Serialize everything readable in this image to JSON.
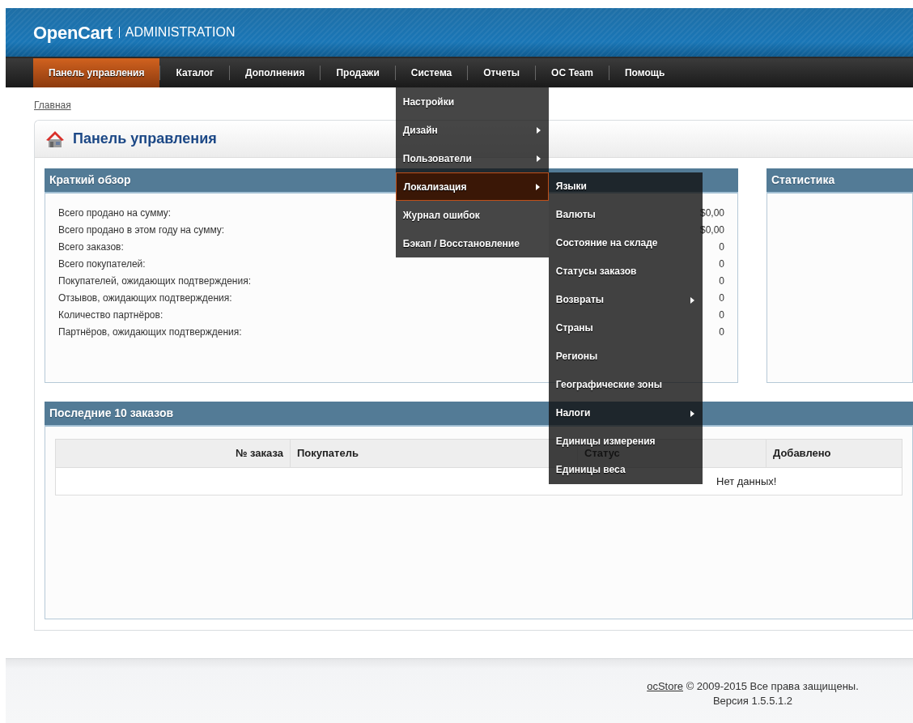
{
  "header": {
    "logo": "OpenCart",
    "subtitle": "ADMINISTRATION"
  },
  "nav": [
    {
      "label": "Панель управления",
      "selected": true
    },
    {
      "label": "Каталог",
      "selected": false
    },
    {
      "label": "Дополнения",
      "selected": false
    },
    {
      "label": "Продажи",
      "selected": false
    },
    {
      "label": "Система",
      "selected": false,
      "expanded": true,
      "children": [
        {
          "label": "Настройки",
          "arrow": false,
          "selected": false
        },
        {
          "label": "Дизайн",
          "arrow": true,
          "selected": false
        },
        {
          "label": "Пользователи",
          "arrow": true,
          "selected": false
        },
        {
          "label": "Локализация",
          "arrow": true,
          "selected": true,
          "expanded": true,
          "children": [
            {
              "label": "Языки",
              "arrow": false
            },
            {
              "label": "Валюты",
              "arrow": false
            },
            {
              "label": "Состояние на складе",
              "arrow": false
            },
            {
              "label": "Статусы заказов",
              "arrow": false
            },
            {
              "label": "Возвраты",
              "arrow": true
            },
            {
              "label": "Страны",
              "arrow": false
            },
            {
              "label": "Регионы",
              "arrow": false
            },
            {
              "label": "Географические зоны",
              "arrow": false
            },
            {
              "label": "Налоги",
              "arrow": true
            },
            {
              "label": "Единицы измерения",
              "arrow": false
            },
            {
              "label": "Единицы веса",
              "arrow": false
            }
          ]
        },
        {
          "label": "Журнал ошибок",
          "arrow": false,
          "selected": false
        },
        {
          "label": "Бэкап / Восстановление",
          "arrow": false,
          "selected": false
        }
      ]
    },
    {
      "label": "Отчеты",
      "selected": false
    },
    {
      "label": "OC Team",
      "selected": false
    },
    {
      "label": "Помощь",
      "selected": false
    }
  ],
  "breadcrumb": [
    "Главная"
  ],
  "page_title": "Панель управления",
  "overview": {
    "title": "Краткий обзор",
    "rows": [
      {
        "label": "Всего продано на сумму:",
        "value": "$0,00"
      },
      {
        "label": "Всего продано в этом году на сумму:",
        "value": "$0,00"
      },
      {
        "label": "Всего заказов:",
        "value": "0"
      },
      {
        "label": "Всего покупателей:",
        "value": "0"
      },
      {
        "label": "Покупателей, ожидающих подтверждения:",
        "value": "0"
      },
      {
        "label": "Отзывов, ожидающих подтверждения:",
        "value": "0"
      },
      {
        "label": "Количество партнёров:",
        "value": "0"
      },
      {
        "label": "Партнёров, ожидающих подтверждения:",
        "value": "0"
      }
    ]
  },
  "statistics": {
    "title": "Статистика"
  },
  "latest_orders": {
    "title": "Последние 10 заказов",
    "columns": [
      "№ заказа",
      "Покупатель",
      "Статус",
      "Добавлено"
    ],
    "empty_text": "Нет данных!"
  },
  "footer": {
    "link": "ocStore",
    "text": "© 2009-2015 Все права защищены.",
    "version": "Версия 1.5.5.1.2"
  }
}
